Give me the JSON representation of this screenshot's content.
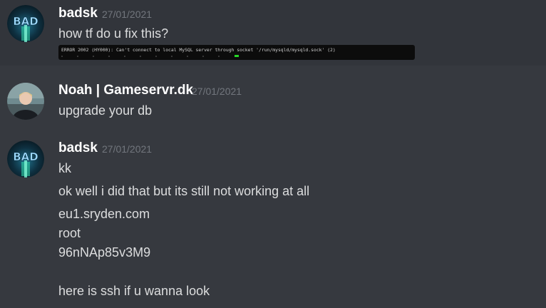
{
  "colors": {
    "background": "#36393f",
    "username": "#ffffff",
    "timestamp": "#72767d",
    "message_text": "#dcddde",
    "terminal_bg": "#0c0c0c",
    "terminal_cursor": "#26d626"
  },
  "messages": [
    {
      "author": "badsk",
      "timestamp": "27/01/2021",
      "avatar_icon": "bad-logo-avatar",
      "lines": [
        "how tf do u fix this?"
      ],
      "attachment_text": "ERROR 2002 (HY000): Can't connect to local MySQL server through socket '/run/mysqld/mysqld.sock' (2)"
    },
    {
      "author": "Noah | Gameservr.dk",
      "timestamp": "27/01/2021",
      "avatar_icon": "person-photo-avatar",
      "lines": [
        "upgrade your db"
      ]
    },
    {
      "author": "badsk",
      "timestamp": "27/01/2021",
      "avatar_icon": "bad-logo-avatar",
      "lines": [
        "kk",
        "ok well i did that but its still not working at all",
        "eu1.sryden.com",
        "root",
        "96nNAp85v3M9",
        "here is ssh if u wanna look"
      ]
    }
  ]
}
